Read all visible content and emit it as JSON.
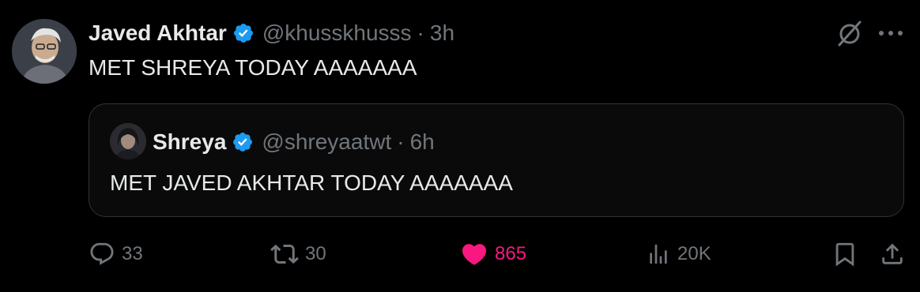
{
  "post": {
    "author": {
      "name": "Javed Akhtar",
      "handle": "@khusskhusss",
      "verified": true,
      "avatar_icon": "user-avatar"
    },
    "separator": "·",
    "time": "3h",
    "text": "MET SHREYA TODAY AAAAAAA",
    "quoted": {
      "author": {
        "name": "Shreya",
        "handle": "@shreyaatwt",
        "verified": true,
        "avatar_icon": "user-avatar"
      },
      "separator": "·",
      "time": "6h",
      "text": "MET JAVED AKHTAR TODAY AAAAAAA"
    },
    "actions": {
      "replies": "33",
      "reposts": "30",
      "likes": "865",
      "views": "20K",
      "liked": true
    }
  },
  "colors": {
    "background": "#000000",
    "primary_text": "#e7e9ea",
    "secondary_text": "#71767b",
    "verified_blue": "#1d9bf0",
    "like_pink": "#f91880",
    "border": "#2f3336"
  },
  "icons": {
    "verified": "verified-badge-icon",
    "grok": "grok-icon",
    "more": "more-icon",
    "reply": "reply-icon",
    "repost": "repost-icon",
    "like": "heart-icon",
    "views": "views-icon",
    "bookmark": "bookmark-icon",
    "share": "share-icon"
  }
}
